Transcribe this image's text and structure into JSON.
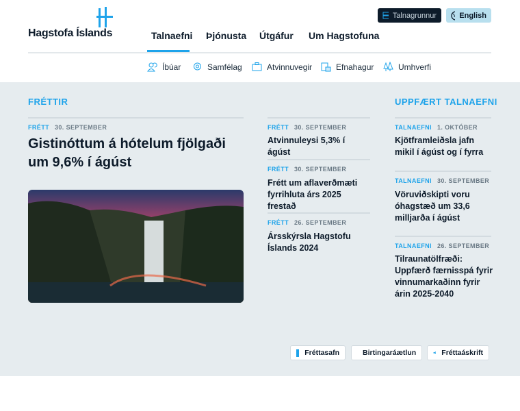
{
  "header": {
    "logo_text": "Hagstofa Íslands",
    "nav": [
      "Talnaefni",
      "Þjónusta",
      "Útgáfur",
      "Um Hagstofuna"
    ],
    "talnagrunnur_label": "Talnagrunnur",
    "english_label": "English",
    "subnav": [
      "Íbúar",
      "Samfélag",
      "Atvinnuvegir",
      "Efnahagur",
      "Umhverfi"
    ]
  },
  "news": {
    "heading": "FRÉTTIR",
    "featured": {
      "type": "FRÉTT",
      "date": "30. SEPTEMBER",
      "title": "Gistinóttum á hótelum fjölgaði um 9,6% í ágúst"
    },
    "items": [
      {
        "type": "FRÉTT",
        "date": "30. SEPTEMBER",
        "title": "Atvinnuleysi 5,3% í ágúst"
      },
      {
        "type": "FRÉTT",
        "date": "30. SEPTEMBER",
        "title": "Frétt um aflaverðmæti fyrrihluta árs 2025 frestað"
      },
      {
        "type": "FRÉTT",
        "date": "26. SEPTEMBER",
        "title": "Ársskýrsla Hagstofu Íslands 2024"
      }
    ]
  },
  "updated": {
    "heading": "UPPFÆRT TALNAEFNI",
    "items": [
      {
        "type": "TALNAEFNI",
        "date": "1. OKTÓBER",
        "title": "Kjötframleiðsla jafn mikil í ágúst og í fyrra"
      },
      {
        "type": "TALNAEFNI",
        "date": "30. SEPTEMBER",
        "title": "Vöruviðskipti voru óhagstæð um 33,6 milljarða í ágúst"
      },
      {
        "type": "TALNAEFNI",
        "date": "26. SEPTEMBER",
        "title": "Tilraunatölfræði: Uppfærð færnisspá fyrir vinnumarkaðinn fyrir árin 2025-2040"
      }
    ]
  },
  "footer_buttons": [
    "Fréttasafn",
    "Birtingaráætlun",
    "Fréttaáskrift"
  ],
  "colors": {
    "accent": "#1ea3ea",
    "dark": "#0d1b2a",
    "bg": "#e6ecef"
  }
}
